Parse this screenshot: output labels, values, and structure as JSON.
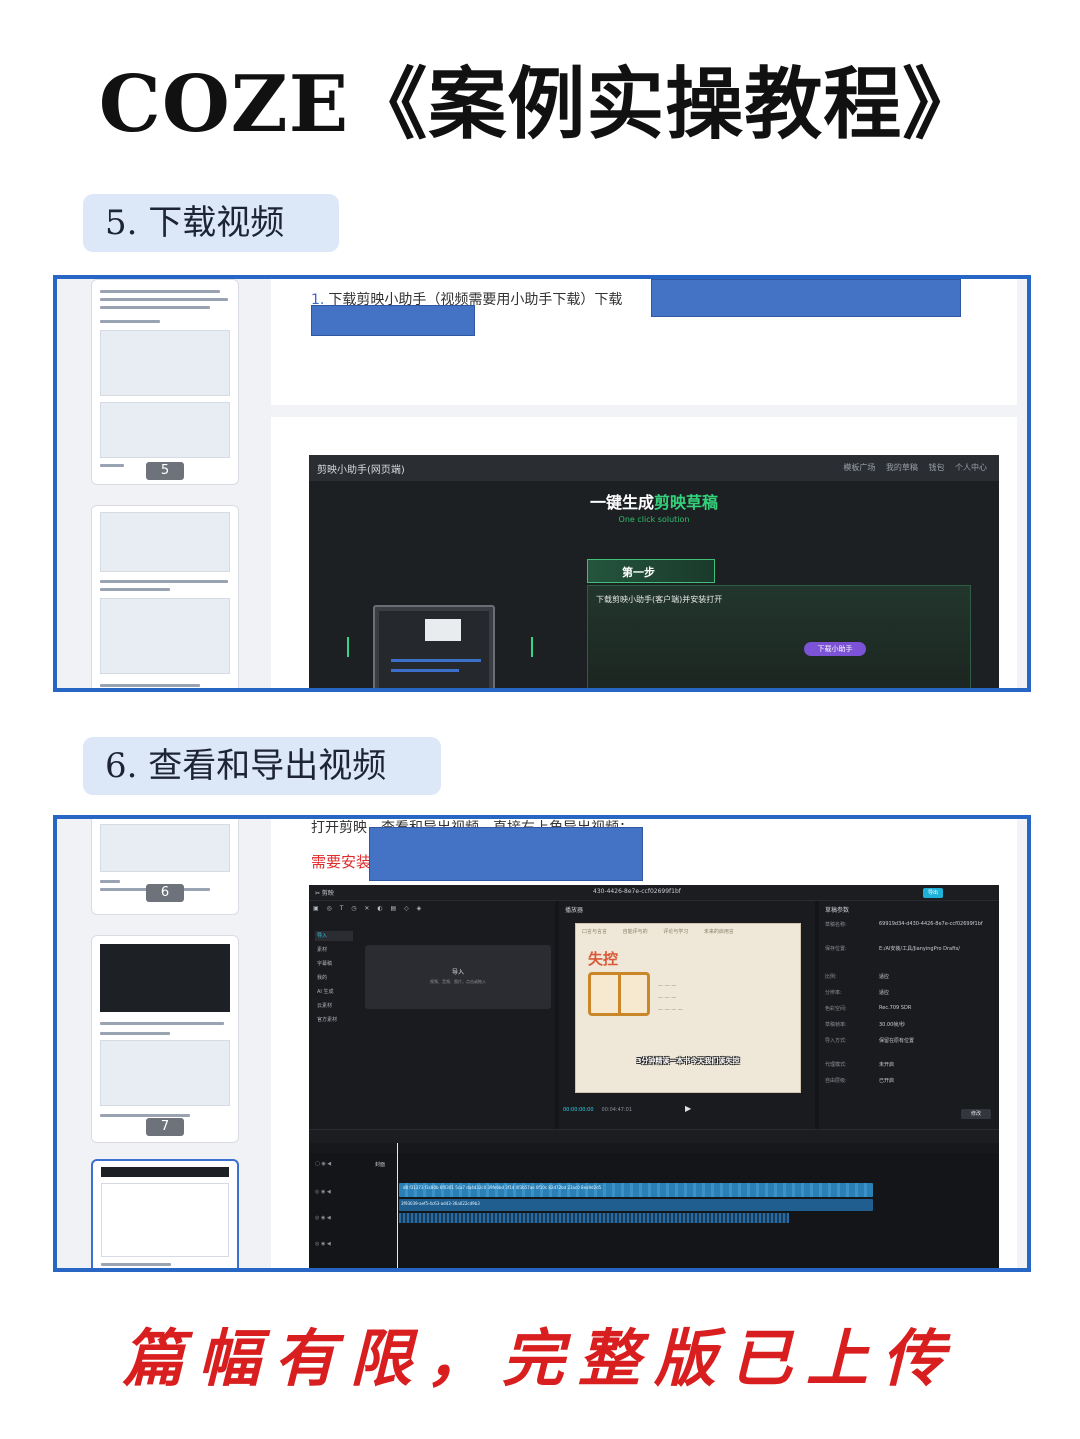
{
  "title": "COZE《案例实操教程》",
  "sections": [
    {
      "label": "5. 下载视频"
    },
    {
      "label": "6. 查看和导出视频"
    }
  ],
  "shot5": {
    "thumb_pages": [
      "5"
    ],
    "step_number": "1.",
    "step_text": "下载剪映小助手（视频需要用小助手下载）下载",
    "jy": {
      "brand": "剪映小助手(网页端)",
      "nav": [
        "模板广场",
        "我的草稿",
        "钱包",
        "个人中心"
      ],
      "hero_prefix": "一键生成",
      "hero_highlight": "剪映草稿",
      "hero_sub": "One click solution",
      "step_tab": "第一步",
      "panel_text": "下载剪映小助手(客户端)并安装打开",
      "download_button": "下载小助手"
    }
  },
  "shot6": {
    "thumb_pages": [
      "6",
      "7"
    ],
    "intro_text": "打开剪映，查看和导出视频，直接右上角导出视频：",
    "red_text": "需要安装",
    "editor": {
      "title": "430-4426-8e7e-ccf02699f1bf",
      "export_label": "导出",
      "categories": [
        "导入",
        "素材",
        "字幕稿",
        "我的",
        "AI 生成",
        "云素材",
        "官方素材"
      ],
      "import_label": "导入",
      "import_hint": "视频、音频、图片，点击或拖入",
      "player_header": "播放器",
      "frame_tabs": [
        "口言与言言",
        "自能评与的",
        "评论与学习",
        "未来的启用言"
      ],
      "frame_big": "失控",
      "frame_caption": "3分钟精读一本书今天我们读失控",
      "time_current": "00:00:00:00",
      "time_total": "00:04:47:01",
      "right_header": "草稿参数",
      "params": [
        {
          "k": "草稿名称:",
          "v": "69919d34-d430-4426-8e7e-ccf02699f1bf"
        },
        {
          "k": "保存位置:",
          "v": "E:/AI安装/工具/JianyingPro Drafts/"
        },
        {
          "k": "比例:",
          "v": "适应"
        },
        {
          "k": "分辨率:",
          "v": "适应"
        },
        {
          "k": "色彩空间:",
          "v": "Rec.709 SDR"
        },
        {
          "k": "草稿帧率:",
          "v": "30.00帧/秒"
        },
        {
          "k": "导入方式:",
          "v": "保留在原有位置"
        },
        {
          "k": "代理模式:",
          "v": "未开启"
        },
        {
          "k": "自由层级:",
          "v": "已开启"
        }
      ],
      "modify_label": "修改",
      "cover_label": "封面",
      "clip_label": "d8 f31373 f3c80b 6f0301 5ca7 da4d32c0 39fe6bd 3f14 4f3b57ae 0f10c 82d72bd 23ac0 8ea9d2d5",
      "clip2_label": "3f93039-aef5-4c63-ad43-36a022cd9b3"
    }
  },
  "footer": "篇幅有限，完整版已上传",
  "colors": {
    "frame_border": "#2866c6",
    "pill_bg": "#dce8f7",
    "footer_red": "#d81e1e",
    "redaction": "#4472c4"
  }
}
